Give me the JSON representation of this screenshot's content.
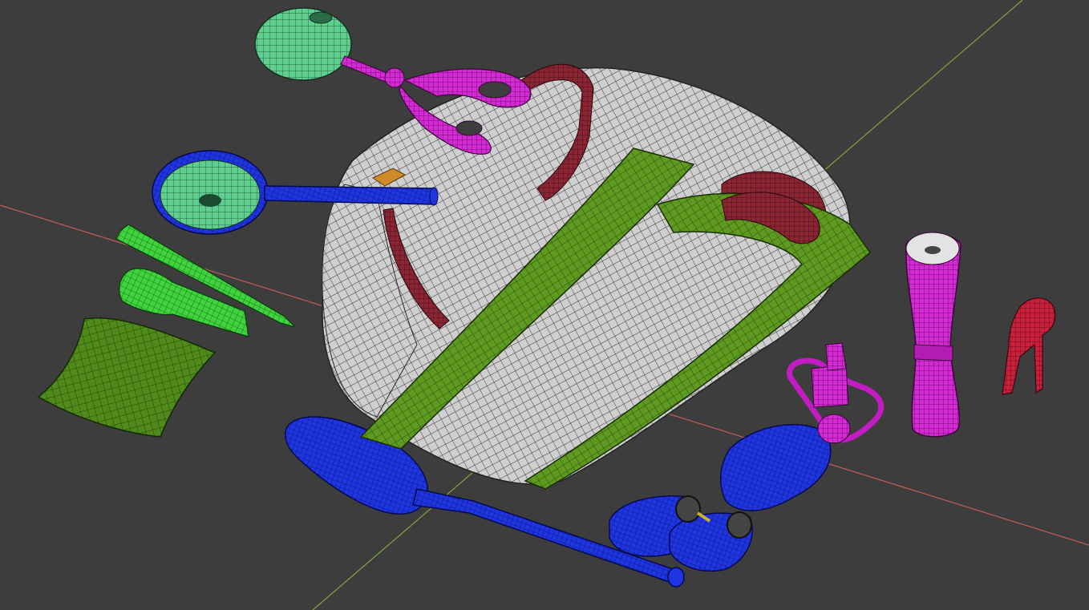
{
  "viewport": {
    "background": "#3d3d3d",
    "axis_x_color": "#c25b5b",
    "axis_y_color": "#7fa63a",
    "shading": "wireframe-on-shaded"
  },
  "objects": [
    {
      "name": "backpack-body",
      "color": "#c8c8c8"
    },
    {
      "name": "backpack-straps",
      "color": "#5a8a1e"
    },
    {
      "name": "backpack-trim",
      "color": "#7a1e2a"
    },
    {
      "name": "magnifying-glass",
      "color": "#1c2fd6"
    },
    {
      "name": "scissors",
      "color": "#c21cc2"
    },
    {
      "name": "compass-lamp",
      "color": "#48b87a"
    },
    {
      "name": "pencil",
      "color": "#36c23a"
    },
    {
      "name": "flashlight",
      "color": "#36c23a"
    },
    {
      "name": "pouch",
      "color": "#4f8a1a"
    },
    {
      "name": "shovel",
      "color": "#1c2fd6"
    },
    {
      "name": "binoculars",
      "color": "#1c2fd6"
    },
    {
      "name": "water-bottle",
      "color": "#1c2fd6"
    },
    {
      "name": "thermos",
      "color": "#c21cc2"
    },
    {
      "name": "tweezers",
      "color": "#b41e2e"
    }
  ]
}
